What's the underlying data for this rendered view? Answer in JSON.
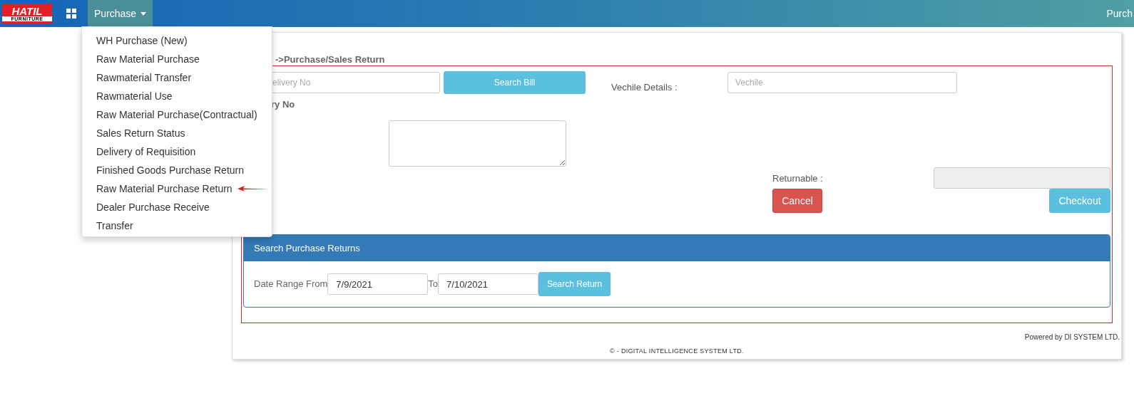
{
  "navbar": {
    "logo": "HATIL",
    "logo_tagline": "FURNITURE",
    "menu": "Purchase",
    "right_text": "Purch"
  },
  "dropdown": {
    "items": [
      {
        "label": "WH Purchase (New)",
        "pointed": false
      },
      {
        "label": "Raw Material Purchase",
        "pointed": false
      },
      {
        "label": "Rawmaterial Transfer",
        "pointed": false
      },
      {
        "label": "Rawmaterial Use",
        "pointed": false
      },
      {
        "label": "Raw Material Purchase(Contractual)",
        "pointed": false
      },
      {
        "label": "Sales Return Status",
        "pointed": false
      },
      {
        "label": "Delivery of Requisition",
        "pointed": false
      },
      {
        "label": "Finished Goods Purchase Return",
        "pointed": false
      },
      {
        "label": "Raw Material Purchase Return",
        "pointed": true
      },
      {
        "label": "Dealer Purchase Receive",
        "pointed": false
      },
      {
        "label": "Transfer",
        "pointed": false
      }
    ]
  },
  "form": {
    "breadcrumb": "->Purchase/Sales Return",
    "delivery_placeholder": "elivery No",
    "search_bill": "Search Bill",
    "vehicle_label": "Vechile Details :",
    "vehicle_placeholder": "Vechile",
    "delivery_label": "ry No",
    "returnable_label": "Returnable :",
    "cancel": "Cancel",
    "checkout": "Checkout"
  },
  "search_panel": {
    "title": "Search Purchase Returns",
    "from_label": "Date Range From",
    "from_value": "7/9/2021",
    "to_label": "To",
    "to_value": "7/10/2021",
    "button": "Search Return"
  },
  "footer": {
    "powered": "Powered by DI SYSTEM LTD.",
    "copyright": "©  - DIGITAL INTELLIGENCE SYSTEM LTD."
  }
}
